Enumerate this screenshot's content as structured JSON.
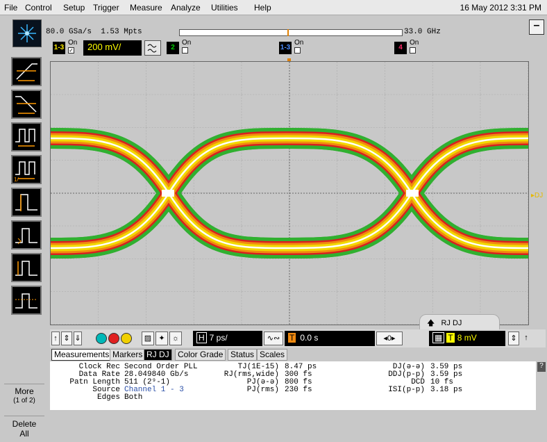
{
  "menu": [
    "File",
    "Control",
    "Setup",
    "Trigger",
    "Measure",
    "Analyze",
    "Utilities",
    "Help"
  ],
  "datetime": "16 May 2012  3:31 PM",
  "acq": {
    "sample_rate": "80.0 GSa/s",
    "memory": "1.53 Mpts",
    "bandwidth": "33.0 GHz"
  },
  "channels": [
    {
      "id": "1-3",
      "on_label": "On",
      "checked": "✓",
      "color": "#ffee00",
      "scale": "200 mV/"
    },
    {
      "id": "2",
      "on_label": "On",
      "color": "#00d000"
    },
    {
      "id": "1-3",
      "on_label": "On",
      "color": "#4a8cff"
    },
    {
      "id": "4",
      "on_label": "On",
      "color": "#ff2b6a"
    }
  ],
  "sidebar": {
    "more": "More",
    "more_page": "(1 of 2)",
    "delete": "Delete",
    "delete_2": "All"
  },
  "scope": {
    "rj_dj_marker": "RJ DJ",
    "right_marker": "▸DJ"
  },
  "controls": {
    "time_scale": "7 ps/",
    "delay": "0.0 s",
    "trig_level": "8 mV",
    "h_label": "H",
    "t_label": "T"
  },
  "tabs": [
    "Measurements",
    "Markers",
    "RJ DJ",
    "Color Grade",
    "Status",
    "Scales"
  ],
  "measurements": {
    "col1": [
      {
        "label": "Clock Rec",
        "value": "Second Order PLL"
      },
      {
        "label": "Data Rate",
        "value": "28.049840 Gb/s"
      },
      {
        "label": "Patn Length",
        "value": "511 (2⁹-1)"
      },
      {
        "label": "Source",
        "value": "Channel 1 - 3"
      },
      {
        "label": "Edges",
        "value": "Both"
      }
    ],
    "col2": [
      {
        "label": "TJ(1E-15)",
        "value": "8.47 ps"
      },
      {
        "label": "RJ(rms,wide)",
        "value": "300 fs"
      },
      {
        "label": "PJ(ə-ə)",
        "value": "800 fs"
      },
      {
        "label": "PJ(rms)",
        "value": "230 fs"
      }
    ],
    "col3": [
      {
        "label": "DJ(ə-ə)",
        "value": "3.59 ps"
      },
      {
        "label": "DDJ(p-p)",
        "value": "3.59 ps"
      },
      {
        "label": "DCD",
        "value": "10 fs"
      },
      {
        "label": "ISI(p-p)",
        "value": "3.18 ps"
      }
    ]
  },
  "help": "?"
}
